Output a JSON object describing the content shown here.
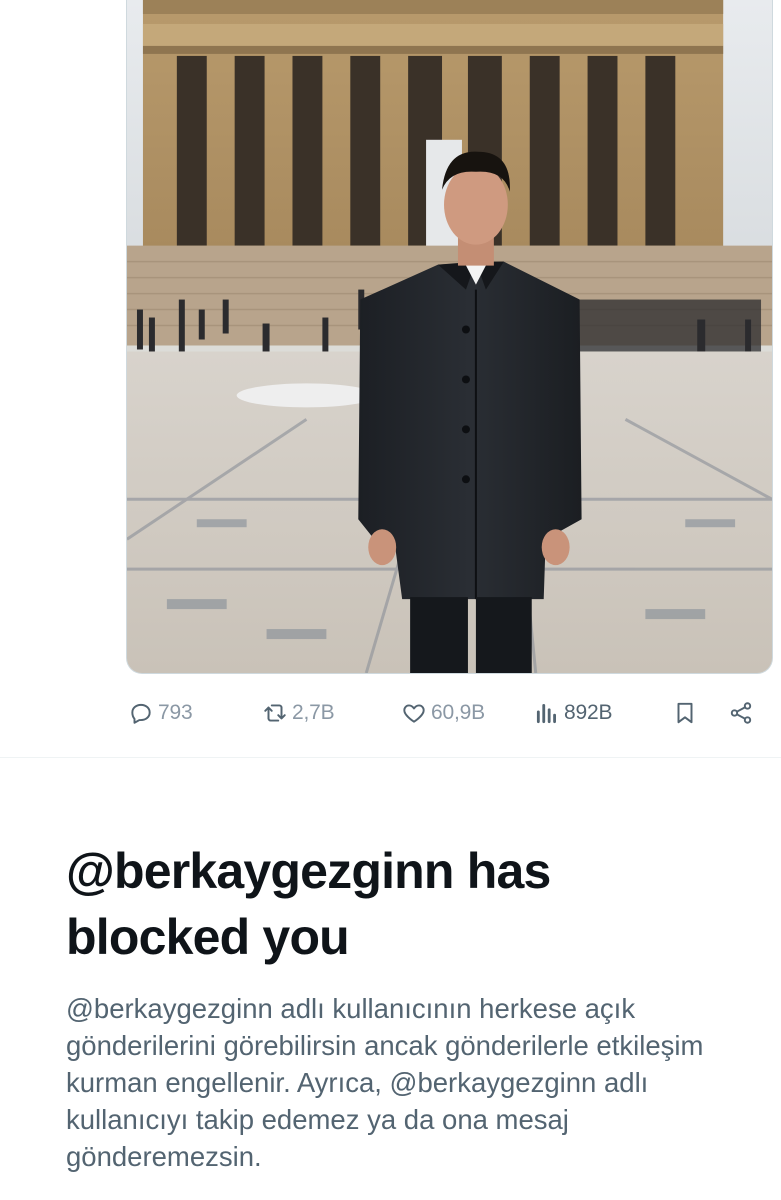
{
  "tweet": {
    "media": {
      "alt_icon": "photo-person-at-monument"
    },
    "actions": {
      "replies": "793",
      "retweets": "2,7B",
      "likes": "60,9B",
      "views": "892B"
    }
  },
  "blocked": {
    "title": "@berkaygezginn has blocked you",
    "body": "@berkaygezginn adlı kullanıcının herkese açık gönderilerini görebilirsin ancak gönderilerle etkileşim kurman engellenir. Ayrıca, @berkaygezginn adlı kullanıcıyı takip edemez ya da ona mesaj gönderemezsin."
  },
  "colors": {
    "text_primary": "#0f1419",
    "text_secondary": "#536471",
    "border": "#cfd9de"
  }
}
